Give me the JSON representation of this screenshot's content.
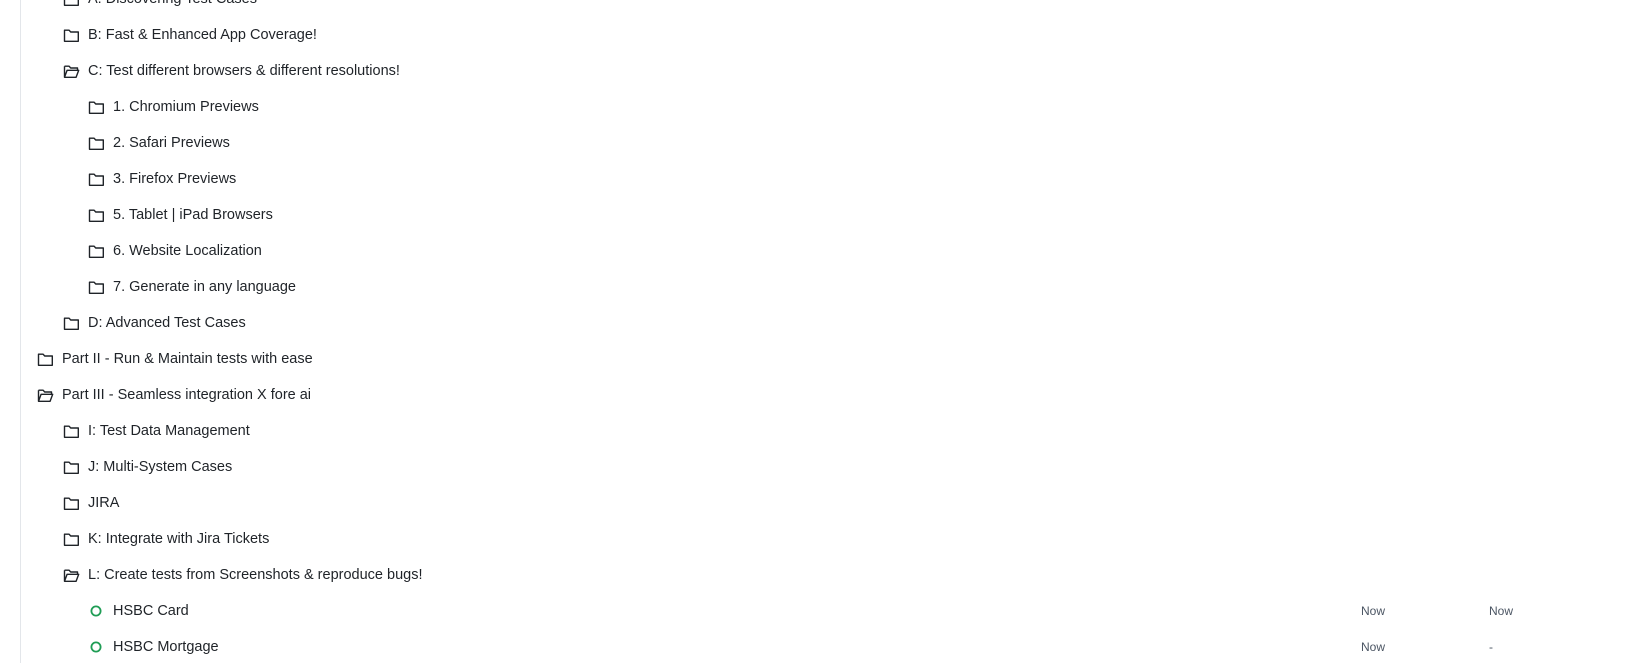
{
  "tree": [
    {
      "id": "a",
      "label": "A: Discovering Test Cases",
      "level": 2,
      "type": "folder"
    },
    {
      "id": "b",
      "label": "B: Fast & Enhanced App Coverage!",
      "level": 2,
      "type": "folder"
    },
    {
      "id": "c",
      "label": "C: Test different browsers & different resolutions!",
      "level": 2,
      "type": "folder-open"
    },
    {
      "id": "c1",
      "label": "1. Chromium Previews",
      "level": 3,
      "type": "folder"
    },
    {
      "id": "c2",
      "label": "2. Safari Previews",
      "level": 3,
      "type": "folder"
    },
    {
      "id": "c3",
      "label": "3. Firefox Previews",
      "level": 3,
      "type": "folder"
    },
    {
      "id": "c5",
      "label": "5. Tablet | iPad Browsers",
      "level": 3,
      "type": "folder"
    },
    {
      "id": "c6",
      "label": "6. Website Localization",
      "level": 3,
      "type": "folder"
    },
    {
      "id": "c7",
      "label": "7. Generate in any language",
      "level": 3,
      "type": "folder"
    },
    {
      "id": "d",
      "label": "D: Advanced Test Cases",
      "level": 2,
      "type": "folder"
    },
    {
      "id": "p2",
      "label": "Part II - Run & Maintain tests with ease",
      "level": 1,
      "type": "folder"
    },
    {
      "id": "p3",
      "label": "Part III - Seamless integration X fore ai",
      "level": 1,
      "type": "folder-open"
    },
    {
      "id": "i",
      "label": "I: Test Data Management",
      "level": 2,
      "type": "folder"
    },
    {
      "id": "j",
      "label": "J: Multi-System Cases",
      "level": 2,
      "type": "folder"
    },
    {
      "id": "jira",
      "label": "JIRA",
      "level": 2,
      "type": "folder"
    },
    {
      "id": "k",
      "label": "K: Integrate with Jira Tickets",
      "level": 2,
      "type": "folder"
    },
    {
      "id": "l",
      "label": "L: Create tests from Screenshots & reproduce bugs!",
      "level": 2,
      "type": "folder-open"
    },
    {
      "id": "hsbc-card",
      "label": "HSBC Card",
      "level": 3,
      "type": "test",
      "col_a": "Now",
      "col_b": "Now"
    },
    {
      "id": "hsbc-mortgage",
      "label": "HSBC Mortgage",
      "level": 3,
      "type": "test",
      "col_a": "Now",
      "col_b": "-"
    }
  ],
  "colors": {
    "icon": "#1f2328",
    "status_ring": "#1f9d55",
    "rail": "#e3e6ea"
  },
  "icons": {
    "folder": "folder-icon",
    "folder-open": "folder-open-icon",
    "test": "status-circle-icon"
  }
}
